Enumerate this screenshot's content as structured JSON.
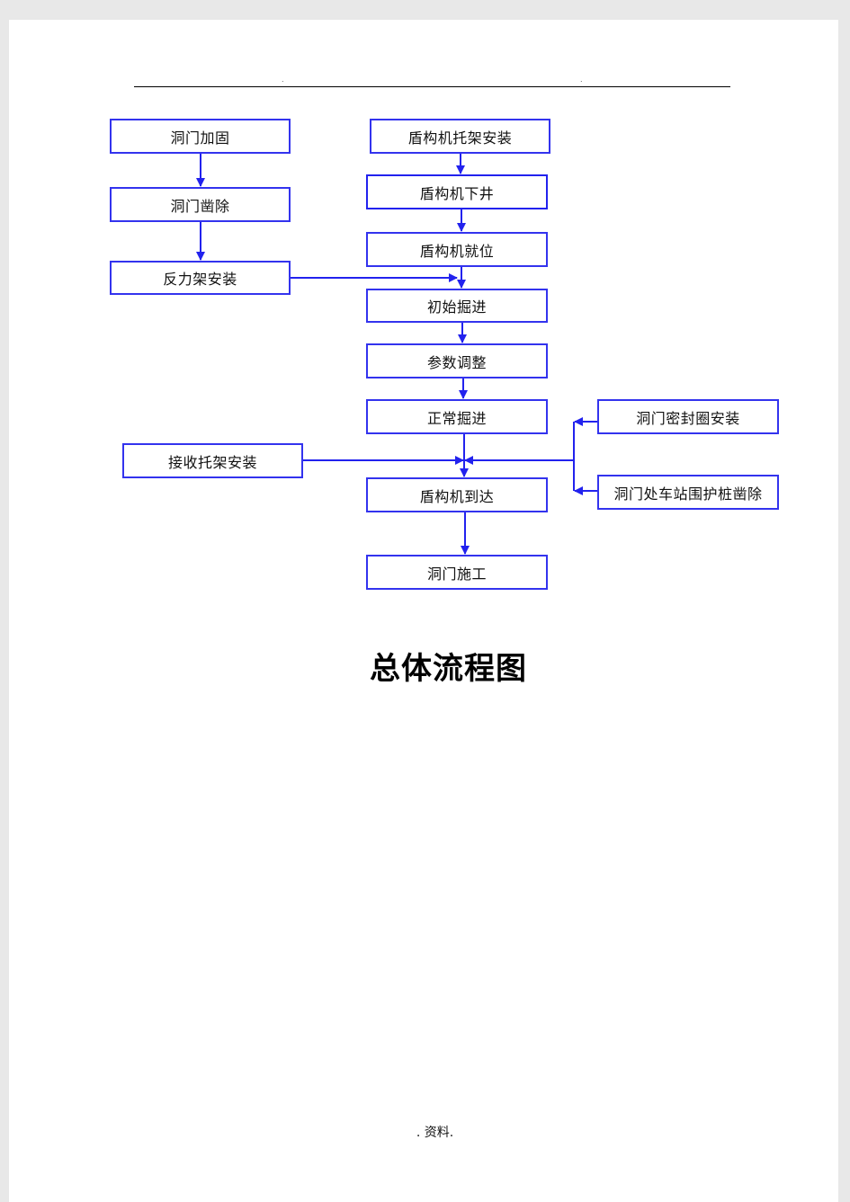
{
  "header": {
    "dot_left": ".",
    "dot_right": "."
  },
  "flowchart": {
    "nodes": {
      "n1": "洞门加固",
      "n2": "洞门凿除",
      "n3": "反力架安装",
      "n4": "盾构机托架安装",
      "n5": "盾构机下井",
      "n6": "盾构机就位",
      "n7": "初始掘进",
      "n8": "参数调整",
      "n9": "正常掘进",
      "n10": "接收托架安装",
      "n11": "盾构机到达",
      "n12": "洞门施工",
      "n13": "洞门密封圈安装",
      "n14": "洞门处车站围护桩凿除"
    },
    "edges": [
      [
        "n1",
        "n2"
      ],
      [
        "n2",
        "n3"
      ],
      [
        "n3",
        "n7"
      ],
      [
        "n4",
        "n5"
      ],
      [
        "n5",
        "n6"
      ],
      [
        "n6",
        "n7"
      ],
      [
        "n7",
        "n8"
      ],
      [
        "n8",
        "n9"
      ],
      [
        "n9",
        "n11"
      ],
      [
        "n10",
        "n11"
      ],
      [
        "n13",
        "n11"
      ],
      [
        "n14",
        "n11"
      ],
      [
        "n11",
        "n12"
      ]
    ],
    "line_color": "#2222ee"
  },
  "title": "总体流程图",
  "footer": ". 资料."
}
